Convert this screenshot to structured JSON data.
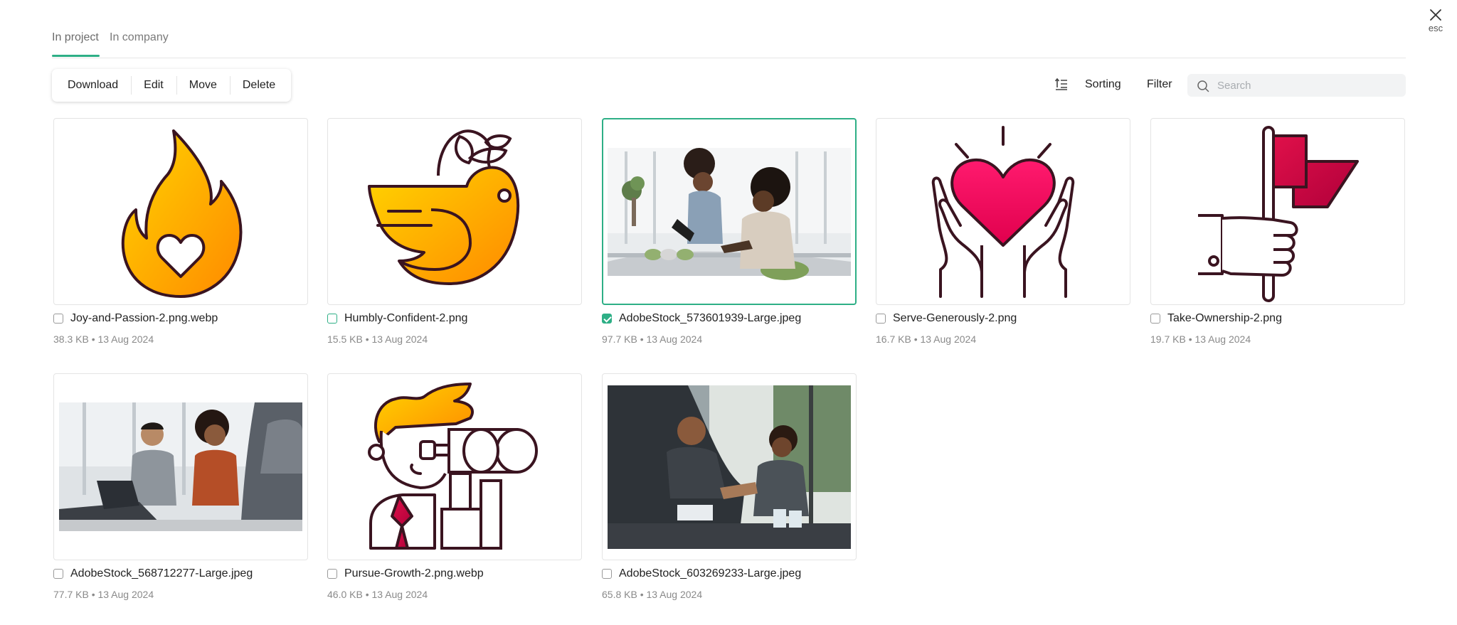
{
  "close": {
    "hint": "esc"
  },
  "tabs": [
    {
      "label": "In project"
    },
    {
      "label": "In company"
    }
  ],
  "actions": [
    "Download",
    "Edit",
    "Move",
    "Delete"
  ],
  "toolbar": {
    "sorting_label": "Sorting",
    "filter_label": "Filter",
    "search_placeholder": "Search"
  },
  "colors": {
    "accent": "#2eaf86"
  },
  "files": [
    {
      "name": "Joy-and-Passion-2.png.webp",
      "meta": "38.3 KB • 13 Aug 2024",
      "checked": false,
      "icon": "flame-heart-icon"
    },
    {
      "name": "Humbly-Confident-2.png",
      "meta": "15.5 KB • 13 Aug 2024",
      "checked": false,
      "icon": "dove-icon"
    },
    {
      "name": "AdobeStock_573601939-Large.jpeg",
      "meta": "97.7 KB • 13 Aug 2024",
      "checked": true,
      "icon": "photo-two-women-tablet"
    },
    {
      "name": "Serve-Generously-2.png",
      "meta": "16.7 KB • 13 Aug 2024",
      "checked": false,
      "icon": "hands-heart-icon"
    },
    {
      "name": "Take-Ownership-2.png",
      "meta": "19.7 KB • 13 Aug 2024",
      "checked": false,
      "icon": "hand-flag-icon"
    },
    {
      "name": "AdobeStock_568712277-Large.jpeg",
      "meta": "77.7 KB • 13 Aug 2024",
      "checked": false,
      "icon": "photo-team-meeting"
    },
    {
      "name": "Pursue-Growth-2.png.webp",
      "meta": "46.0 KB • 13 Aug 2024",
      "checked": false,
      "icon": "person-binoculars-icon"
    },
    {
      "name": "AdobeStock_603269233-Large.jpeg",
      "meta": "65.8 KB • 13 Aug 2024",
      "checked": false,
      "icon": "photo-handshake"
    }
  ]
}
